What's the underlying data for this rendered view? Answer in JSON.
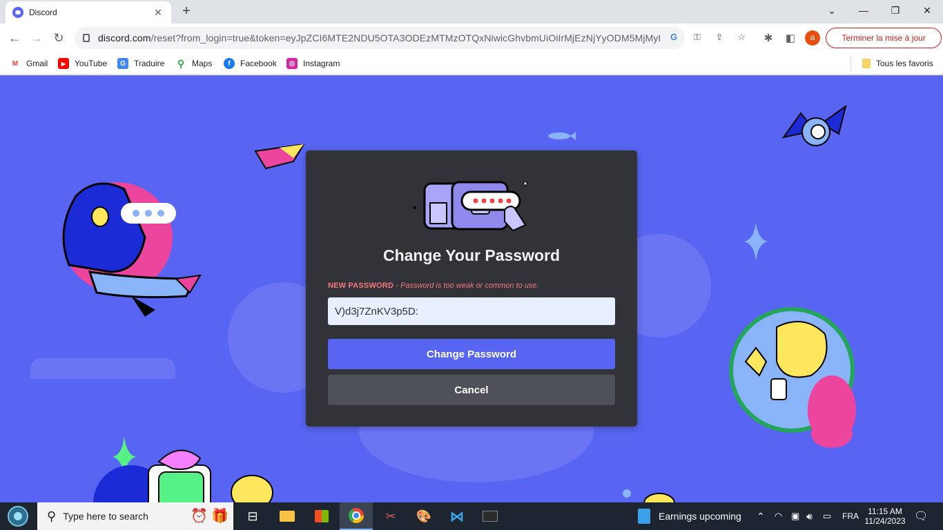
{
  "browser": {
    "tab_title": "Discord",
    "tab_close": "✕",
    "new_tab": "+",
    "url_host": "discord.com",
    "url_rest": "/reset?from_login=true&token=eyJpZCI6MTE2NDU5OTA3ODEzMTMzOTQxNiwicGhvbmUiOiIrMjEzNjYyODM5MjMyIn...",
    "avatar_letter": "a",
    "update_button": "Terminer la mise à jour",
    "window_minimize": "⌄",
    "window_min": "—",
    "window_restore": "❐",
    "window_close": "✕"
  },
  "bookmarks": {
    "items": [
      {
        "label": "Gmail",
        "color": "#ea4335",
        "glyph": "M"
      },
      {
        "label": "YouTube",
        "color": "#ff0000",
        "glyph": "▶"
      },
      {
        "label": "Traduire",
        "color": "#4285f4",
        "glyph": "G"
      },
      {
        "label": "Maps",
        "color": "#34a853",
        "glyph": "●"
      },
      {
        "label": "Facebook",
        "color": "#1877f2",
        "glyph": "f"
      },
      {
        "label": "Instagram",
        "color": "#d6249f",
        "glyph": "◎"
      }
    ],
    "all_favorites": "Tous les favoris"
  },
  "modal": {
    "title": "Change Your Password",
    "field_label": "NEW PASSWORD",
    "field_error": "- Password is too weak or common to use.",
    "password_value": "V)d3j7ZnKV3p5D:",
    "change_button": "Change Password",
    "cancel_button": "Cancel"
  },
  "taskbar": {
    "search_placeholder": "Type here to search",
    "weather_text": "Earnings upcoming",
    "language": "FRA",
    "time": "11:15 AM",
    "date": "11/24/2023"
  },
  "colors": {
    "discord_blurple": "#5865f2",
    "modal_bg": "#313338",
    "error_red": "#fa777c",
    "cancel_gray": "#4e5058"
  }
}
